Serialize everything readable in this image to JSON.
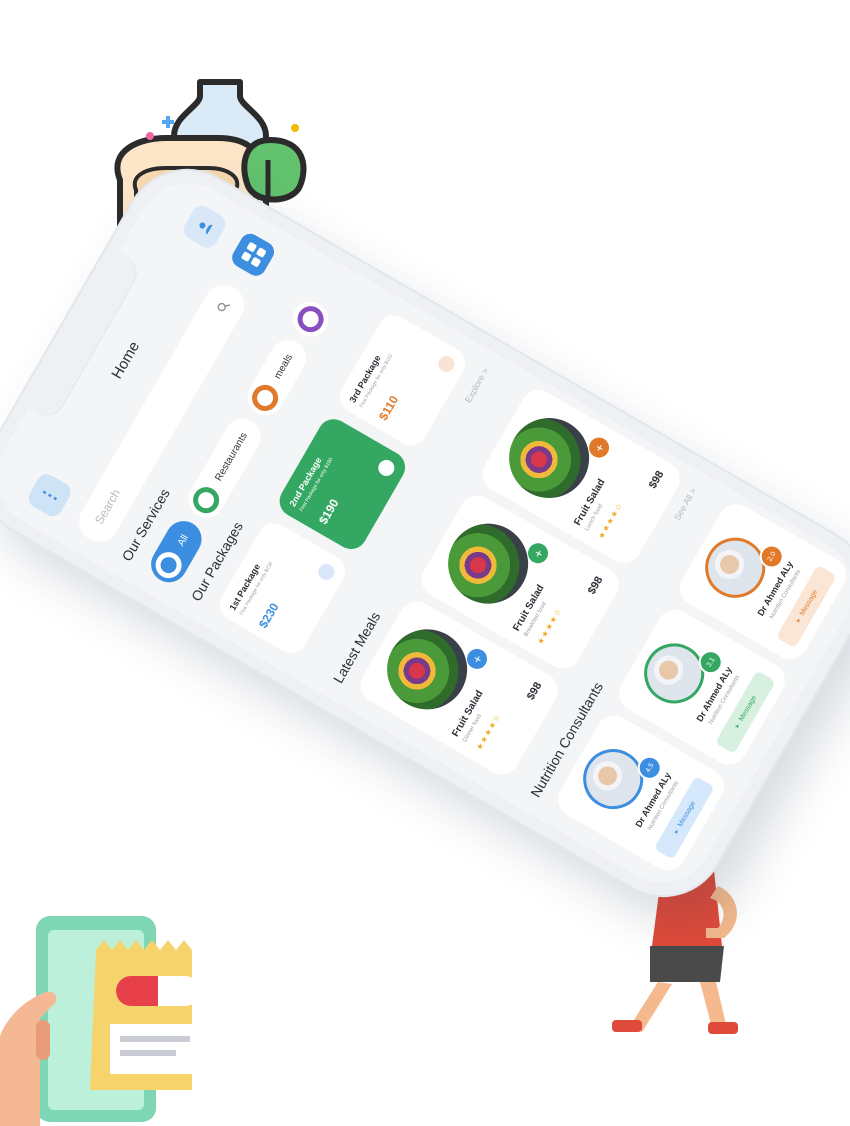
{
  "colors": {
    "blue": "#3b8ee0",
    "green": "#34a862",
    "orange": "#e07a2a",
    "purple": "#8a4fc0"
  },
  "app": {
    "title": "Home",
    "search_placeholder": "Search",
    "menu_icon": "dots-icon",
    "profile_icon": "user-icon",
    "filter_icon": "grid-icon"
  },
  "services": {
    "title": "Our Services",
    "items": [
      {
        "label": "All",
        "color": "#3b8ee0"
      },
      {
        "label": "Restaurants",
        "color": "#34a862"
      },
      {
        "label": "meals",
        "color": "#e07a2a"
      },
      {
        "label": "",
        "color": "#8a4fc0"
      }
    ]
  },
  "packages": {
    "title": "Our Packages",
    "items": [
      {
        "name": "1st Package",
        "desc": "First Package for only $230",
        "price": "$230",
        "color": "#3b8ee0"
      },
      {
        "name": "2nd Package",
        "desc": "First Package for only $190",
        "price": "$190",
        "color": "#34a862"
      },
      {
        "name": "3rd Package",
        "desc": "First Package for only $110",
        "price": "$110",
        "color": "#e07a2a"
      }
    ],
    "link": "Explore >"
  },
  "meals": {
    "title": "Latest Meals",
    "items": [
      {
        "name": "Fruit Salad",
        "category": "Dinner food",
        "stars": "★★★★☆",
        "price": "$98",
        "color": "#3b8ee0"
      },
      {
        "name": "Fruit Salad",
        "category": "Breakfast food",
        "stars": "★★★★☆",
        "price": "$98",
        "color": "#34a862"
      },
      {
        "name": "Fruit Salad",
        "category": "Lunch food",
        "stars": "★★★★☆",
        "price": "$98",
        "color": "#e07a2a"
      }
    ],
    "add_label": "+",
    "link": "See All >"
  },
  "doctors": {
    "title": "Nutrition Consultants",
    "items": [
      {
        "name": "Dr Ahmed ALy",
        "title": "Nutrition Consultants",
        "rating": "4.5",
        "button": "Message",
        "color": "#3b8ee0",
        "tint": "#d6e8fb"
      },
      {
        "name": "Dr Ahmed ALy",
        "title": "Nutrition Consultants",
        "rating": "3.1",
        "button": "Message",
        "color": "#34a862",
        "tint": "#d7f0e0"
      },
      {
        "name": "Dr Ahmed ALy",
        "title": "Nutrition Consultants",
        "rating": "2.0",
        "button": "Message",
        "color": "#e07a2a",
        "tint": "#fbe6d6"
      }
    ]
  },
  "decorations": {
    "groceries_icon": "groceries-icon",
    "exercise_icon": "exercise-person-icon",
    "prescription_icon": "phone-prescription-icon"
  }
}
